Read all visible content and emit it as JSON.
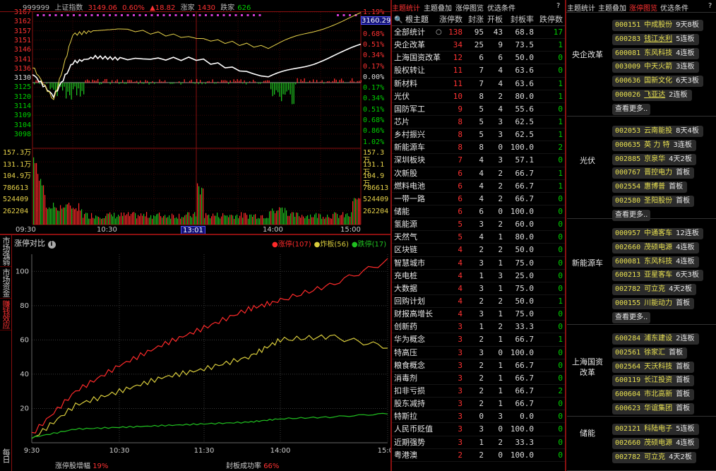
{
  "index_header": {
    "code": "999999",
    "name": "上证指数",
    "price": "3149.06",
    "pct": "0.60%",
    "change": "▲18.82",
    "up_label": "涨家",
    "up_count": "1430",
    "down_label": "跌家",
    "down_count": "626"
  },
  "price_axis_left": [
    "3167",
    "3162",
    "3157",
    "3151",
    "3146",
    "3141",
    "3136",
    "3130",
    "3125",
    "3120",
    "3114",
    "3109",
    "3104",
    "3098"
  ],
  "pct_axis_right": [
    "1.19%",
    "0.86%",
    "0.68%",
    "0.51%",
    "0.34%",
    "0.17%",
    "0.00%",
    "0.17%",
    "0.34%",
    "0.51%",
    "0.68%",
    "0.86%",
    "1.02%"
  ],
  "current_price_tag": "3160.29",
  "vol_axis_left": [
    "157.3万",
    "131.1万",
    "104.9万",
    "786613",
    "524409",
    "262204"
  ],
  "vol_axis_right": [
    "157.3万",
    "131.1万",
    "104.9万",
    "786613",
    "524409",
    "262204"
  ],
  "time_axis": [
    "09:30",
    "10:30",
    "13:01",
    "14:00",
    "15:00"
  ],
  "vtabs": [
    {
      "label": "市场强弱"
    },
    {
      "label": "市场资金"
    },
    {
      "label": "赚钱效应"
    },
    {
      "label": "每日"
    }
  ],
  "compare": {
    "title": "涨停对比",
    "legend": [
      {
        "label": "涨停(107)",
        "color": "#ff2a2a"
      },
      {
        "label": "炸板(56)",
        "color": "#d9cc3c"
      },
      {
        "label": "跌停(17)",
        "color": "#20c020"
      }
    ],
    "y_ticks": [
      "100",
      "80",
      "60",
      "40",
      "20"
    ],
    "x_ticks": [
      "9:30",
      "10:30",
      "11:30",
      "14:00",
      "15:00"
    ],
    "footer_left_label": "涨停股增幅",
    "footer_left_value": "19%",
    "footer_right_label": "封板成功率",
    "footer_right_value": "66%"
  },
  "chart_data": [
    {
      "type": "line",
      "title": "",
      "xlabel": "",
      "ylabel": "",
      "ylim": [
        3098,
        3167
      ],
      "x": [
        "09:30",
        "10:00",
        "10:30",
        "11:00",
        "11:30",
        "13:30",
        "14:00",
        "14:30",
        "15:00"
      ],
      "series": [
        {
          "values": [
            3134,
            3122,
            3140,
            3143,
            3142,
            3142,
            3132,
            3140,
            3149
          ],
          "color": "#ffffff"
        },
        {
          "values": [
            3138,
            3120,
            3155,
            3157,
            3158,
            3153,
            3148,
            3157,
            3166
          ],
          "color": "#e8d34a"
        }
      ]
    },
    {
      "type": "line",
      "title": "涨停对比",
      "xlabel": "",
      "ylabel": "",
      "ylim": [
        0,
        110
      ],
      "x": [
        "9:30",
        "10:00",
        "10:30",
        "11:00",
        "11:30",
        "13:30",
        "14:00",
        "14:30",
        "15:00"
      ],
      "series": [
        {
          "name": "涨停(107)",
          "values": [
            5,
            30,
            45,
            57,
            67,
            78,
            83,
            92,
            106
          ],
          "color": "#ff2a2a"
        },
        {
          "name": "炸板(56)",
          "values": [
            2,
            22,
            30,
            38,
            43,
            50,
            60,
            62,
            56
          ],
          "color": "#d9cc3c"
        },
        {
          "name": "跌停(17)",
          "values": [
            3,
            8,
            9,
            10,
            11,
            12,
            14,
            15,
            17
          ],
          "color": "#20c020"
        }
      ]
    }
  ],
  "theme_tabs": {
    "tabs": [
      "主题统计",
      "主题叠加",
      "涨停图览",
      "优选条件"
    ],
    "active": 0,
    "help": "?"
  },
  "theme_table": {
    "headers": [
      "根主题",
      "涨停数",
      "封涨",
      "开板",
      "封板率",
      "跌停数"
    ],
    "rows": [
      {
        "name": "全部统计",
        "zt": "138",
        "fb": "95",
        "kb": "43",
        "fr": "68.8",
        "dt": "17"
      },
      {
        "name": "央企改革",
        "zt": "34",
        "fb": "25",
        "kb": "9",
        "fr": "73.5",
        "dt": "1"
      },
      {
        "name": "上海国资改革",
        "zt": "12",
        "fb": "6",
        "kb": "6",
        "fr": "50.0",
        "dt": "0"
      },
      {
        "name": "股权转让",
        "zt": "11",
        "fb": "7",
        "kb": "4",
        "fr": "63.6",
        "dt": "0"
      },
      {
        "name": "新材料",
        "zt": "11",
        "fb": "7",
        "kb": "4",
        "fr": "63.6",
        "dt": "1"
      },
      {
        "name": "光伏",
        "zt": "10",
        "fb": "8",
        "kb": "2",
        "fr": "80.0",
        "dt": "1"
      },
      {
        "name": "国防军工",
        "zt": "9",
        "fb": "5",
        "kb": "4",
        "fr": "55.6",
        "dt": "0"
      },
      {
        "name": "芯片",
        "zt": "8",
        "fb": "5",
        "kb": "3",
        "fr": "62.5",
        "dt": "1"
      },
      {
        "name": "乡村振兴",
        "zt": "8",
        "fb": "5",
        "kb": "3",
        "fr": "62.5",
        "dt": "1"
      },
      {
        "name": "新能源车",
        "zt": "8",
        "fb": "8",
        "kb": "0",
        "fr": "100.0",
        "dt": "2"
      },
      {
        "name": "深圳板块",
        "zt": "7",
        "fb": "4",
        "kb": "3",
        "fr": "57.1",
        "dt": "0"
      },
      {
        "name": "次新股",
        "zt": "6",
        "fb": "4",
        "kb": "2",
        "fr": "66.7",
        "dt": "1"
      },
      {
        "name": "燃料电池",
        "zt": "6",
        "fb": "4",
        "kb": "2",
        "fr": "66.7",
        "dt": "1"
      },
      {
        "name": "一带一路",
        "zt": "6",
        "fb": "4",
        "kb": "2",
        "fr": "66.7",
        "dt": "0"
      },
      {
        "name": "储能",
        "zt": "6",
        "fb": "6",
        "kb": "0",
        "fr": "100.0",
        "dt": "0"
      },
      {
        "name": "氢能源",
        "zt": "5",
        "fb": "3",
        "kb": "2",
        "fr": "60.0",
        "dt": "0"
      },
      {
        "name": "天然气",
        "zt": "5",
        "fb": "4",
        "kb": "1",
        "fr": "80.0",
        "dt": "0"
      },
      {
        "name": "区块链",
        "zt": "4",
        "fb": "2",
        "kb": "2",
        "fr": "50.0",
        "dt": "0"
      },
      {
        "name": "智慧城市",
        "zt": "4",
        "fb": "3",
        "kb": "1",
        "fr": "75.0",
        "dt": "0"
      },
      {
        "name": "充电桩",
        "zt": "4",
        "fb": "1",
        "kb": "3",
        "fr": "25.0",
        "dt": "0"
      },
      {
        "name": "大数据",
        "zt": "4",
        "fb": "3",
        "kb": "1",
        "fr": "75.0",
        "dt": "0"
      },
      {
        "name": "回购计划",
        "zt": "4",
        "fb": "2",
        "kb": "2",
        "fr": "50.0",
        "dt": "1"
      },
      {
        "name": "财报高增长",
        "zt": "4",
        "fb": "3",
        "kb": "1",
        "fr": "75.0",
        "dt": "0"
      },
      {
        "name": "创新药",
        "zt": "3",
        "fb": "1",
        "kb": "2",
        "fr": "33.3",
        "dt": "0"
      },
      {
        "name": "华为概念",
        "zt": "3",
        "fb": "2",
        "kb": "1",
        "fr": "66.7",
        "dt": "1"
      },
      {
        "name": "特高压",
        "zt": "3",
        "fb": "3",
        "kb": "0",
        "fr": "100.0",
        "dt": "0"
      },
      {
        "name": "粮食概念",
        "zt": "3",
        "fb": "2",
        "kb": "1",
        "fr": "66.7",
        "dt": "0"
      },
      {
        "name": "消毒剂",
        "zt": "3",
        "fb": "2",
        "kb": "1",
        "fr": "66.7",
        "dt": "0"
      },
      {
        "name": "扣非亏损",
        "zt": "3",
        "fb": "2",
        "kb": "1",
        "fr": "66.7",
        "dt": "2"
      },
      {
        "name": "股东减持",
        "zt": "3",
        "fb": "2",
        "kb": "1",
        "fr": "66.7",
        "dt": "0"
      },
      {
        "name": "特斯拉",
        "zt": "3",
        "fb": "0",
        "kb": "3",
        "fr": "0.0",
        "dt": "0"
      },
      {
        "name": "人民币贬值",
        "zt": "3",
        "fb": "3",
        "kb": "0",
        "fr": "100.0",
        "dt": "0"
      },
      {
        "name": "近期强势",
        "zt": "3",
        "fb": "1",
        "kb": "2",
        "fr": "33.3",
        "dt": "0"
      },
      {
        "name": "粤港澳",
        "zt": "2",
        "fb": "2",
        "kb": "0",
        "fr": "100.0",
        "dt": "0"
      }
    ]
  },
  "right_tabs": {
    "tabs": [
      "主题统计",
      "主题叠加",
      "涨停图览",
      "优选条件"
    ],
    "active": 2,
    "help": "?"
  },
  "groups": [
    {
      "name": "央企改革",
      "more": "查看更多..",
      "stocks": [
        {
          "code": "000151",
          "name": "中成股份",
          "label": "9天8板",
          "hl": false
        },
        {
          "code": "600283",
          "name": "钱江水利",
          "label": "5连板",
          "hl": true
        },
        {
          "code": "600081",
          "name": "东风科技",
          "label": "4连板",
          "hl": false
        },
        {
          "code": "003009",
          "name": "中天火箭",
          "label": "3连板",
          "hl": false
        },
        {
          "code": "600636",
          "name": "国新文化",
          "label": "6天3板",
          "hl": false
        },
        {
          "code": "000026",
          "name": "飞亚达",
          "label": "2连板",
          "hl": true
        }
      ]
    },
    {
      "name": "光伏",
      "more": "查看更多..",
      "stocks": [
        {
          "code": "002053",
          "name": "云南能投",
          "label": "8天4板",
          "hl": false
        },
        {
          "code": "000635",
          "name": "英 力 特",
          "label": "3连板",
          "hl": false
        },
        {
          "code": "002885",
          "name": "京泉华",
          "label": "4天2板",
          "hl": false
        },
        {
          "code": "000767",
          "name": "晋控电力",
          "label": "首板",
          "hl": false
        },
        {
          "code": "002554",
          "name": "惠博普",
          "label": "首板",
          "hl": false
        },
        {
          "code": "002580",
          "name": "圣阳股份",
          "label": "首板",
          "hl": false
        }
      ]
    },
    {
      "name": "新能源车",
      "more": "查看更多..",
      "stocks": [
        {
          "code": "000957",
          "name": "中通客车",
          "label": "12连板",
          "hl": false
        },
        {
          "code": "002660",
          "name": "茂硕电源",
          "label": "4连板",
          "hl": false
        },
        {
          "code": "600081",
          "name": "东风科技",
          "label": "4连板",
          "hl": false
        },
        {
          "code": "600213",
          "name": "亚星客车",
          "label": "6天3板",
          "hl": false
        },
        {
          "code": "002782",
          "name": "可立克",
          "label": "4天2板",
          "hl": false
        },
        {
          "code": "000155",
          "name": "川能动力",
          "label": "首板",
          "hl": false
        }
      ]
    },
    {
      "name": "上海国资改革",
      "more": "",
      "stocks": [
        {
          "code": "600284",
          "name": "浦东建设",
          "label": "2连板",
          "hl": false
        },
        {
          "code": "002561",
          "name": "徐家汇",
          "label": "首板",
          "hl": false
        },
        {
          "code": "002564",
          "name": "天沃科技",
          "label": "首板",
          "hl": false
        },
        {
          "code": "600119",
          "name": "长江投资",
          "label": "首板",
          "hl": false
        },
        {
          "code": "600604",
          "name": "市北高新",
          "label": "首板",
          "hl": false
        },
        {
          "code": "600623",
          "name": "华谊集团",
          "label": "首板",
          "hl": false
        }
      ]
    },
    {
      "name": "储能",
      "more": "",
      "stocks": [
        {
          "code": "002121",
          "name": "科陆电子",
          "label": "5连板",
          "hl": false
        },
        {
          "code": "002660",
          "name": "茂硕电源",
          "label": "4连板",
          "hl": false
        },
        {
          "code": "002782",
          "name": "可立克",
          "label": "4天2板",
          "hl": false
        }
      ]
    }
  ]
}
